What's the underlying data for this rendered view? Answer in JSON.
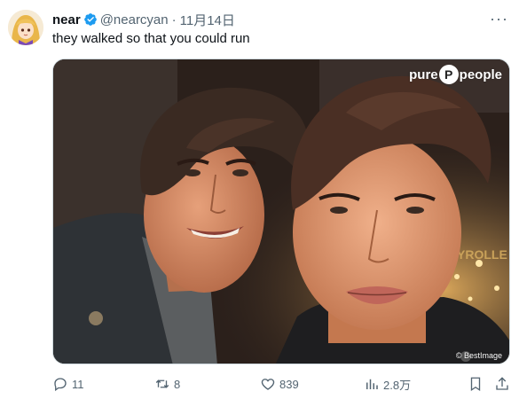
{
  "author": {
    "display_name": "near",
    "handle": "@nearcyan",
    "date": "11月14日",
    "verified": true
  },
  "tweet": {
    "text": "they walked so that you could run"
  },
  "media": {
    "watermark_top_left": "pure",
    "watermark_top_logo": "P",
    "watermark_top_right": "people",
    "watermark_bottom": "© BestImage"
  },
  "actions": {
    "replies": "11",
    "retweets": "8",
    "likes": "839",
    "views": "2.8万"
  },
  "more_label": "···",
  "colors": {
    "accent": "#1d9bf0",
    "muted": "#536471",
    "text": "#0f1419"
  }
}
